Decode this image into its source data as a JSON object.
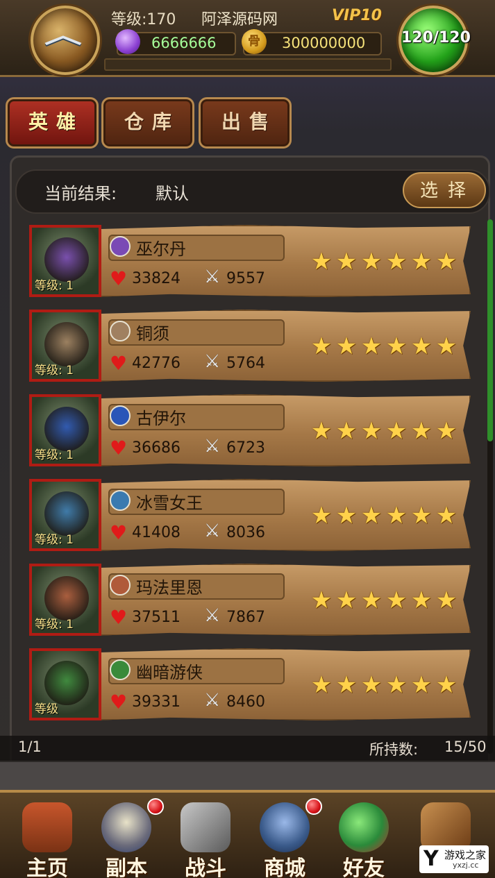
{
  "header": {
    "level_text": "等级:170",
    "title": "阿泽源码网",
    "vip": "VIP10",
    "gems": "6666666",
    "gold": "300000000",
    "gold_icon_glyph": "骨",
    "energy": "120/120"
  },
  "tabs": [
    {
      "label": "英雄",
      "active": true
    },
    {
      "label": "仓库",
      "active": false
    },
    {
      "label": "出售",
      "active": false
    }
  ],
  "filter": {
    "label": "当前结果:",
    "value": "默认",
    "select_label": "选择"
  },
  "heroes": [
    {
      "name": "巫尔丹",
      "hp": "33824",
      "atk": "9557",
      "level": "等级: 1",
      "stars": 6,
      "class_color": "#7a4ab5"
    },
    {
      "name": "铜须",
      "hp": "42776",
      "atk": "5764",
      "level": "等级: 1",
      "stars": 6,
      "class_color": "#a08060"
    },
    {
      "name": "古伊尔",
      "hp": "36686",
      "atk": "6723",
      "level": "等级: 1",
      "stars": 6,
      "class_color": "#2a56b8"
    },
    {
      "name": "冰雪女王",
      "hp": "41408",
      "atk": "8036",
      "level": "等级: 1",
      "stars": 6,
      "class_color": "#3a7ab0"
    },
    {
      "name": "玛法里恩",
      "hp": "37511",
      "atk": "7867",
      "level": "等级: 1",
      "stars": 6,
      "class_color": "#b05a3a"
    },
    {
      "name": "幽暗游侠",
      "hp": "39331",
      "atk": "8460",
      "level": "等级",
      "stars": 6,
      "class_color": "#3a8a3a"
    }
  ],
  "pagination": {
    "page": "1/1",
    "held_label": "所持数:",
    "held_value": "15/50"
  },
  "nav": [
    {
      "label": "主页",
      "badge": false
    },
    {
      "label": "副本",
      "badge": true
    },
    {
      "label": "战斗",
      "badge": false
    },
    {
      "label": "商城",
      "badge": true
    },
    {
      "label": "好友",
      "badge": false
    }
  ],
  "watermark": {
    "big": "Y",
    "text": "游戏之家",
    "url": "yxzj.cc"
  },
  "colors": {
    "accent_red": "#b03124",
    "gem_green": "#a6ff9a",
    "gold_yellow": "#f6e27a",
    "star_gold": "#ffd24a"
  }
}
